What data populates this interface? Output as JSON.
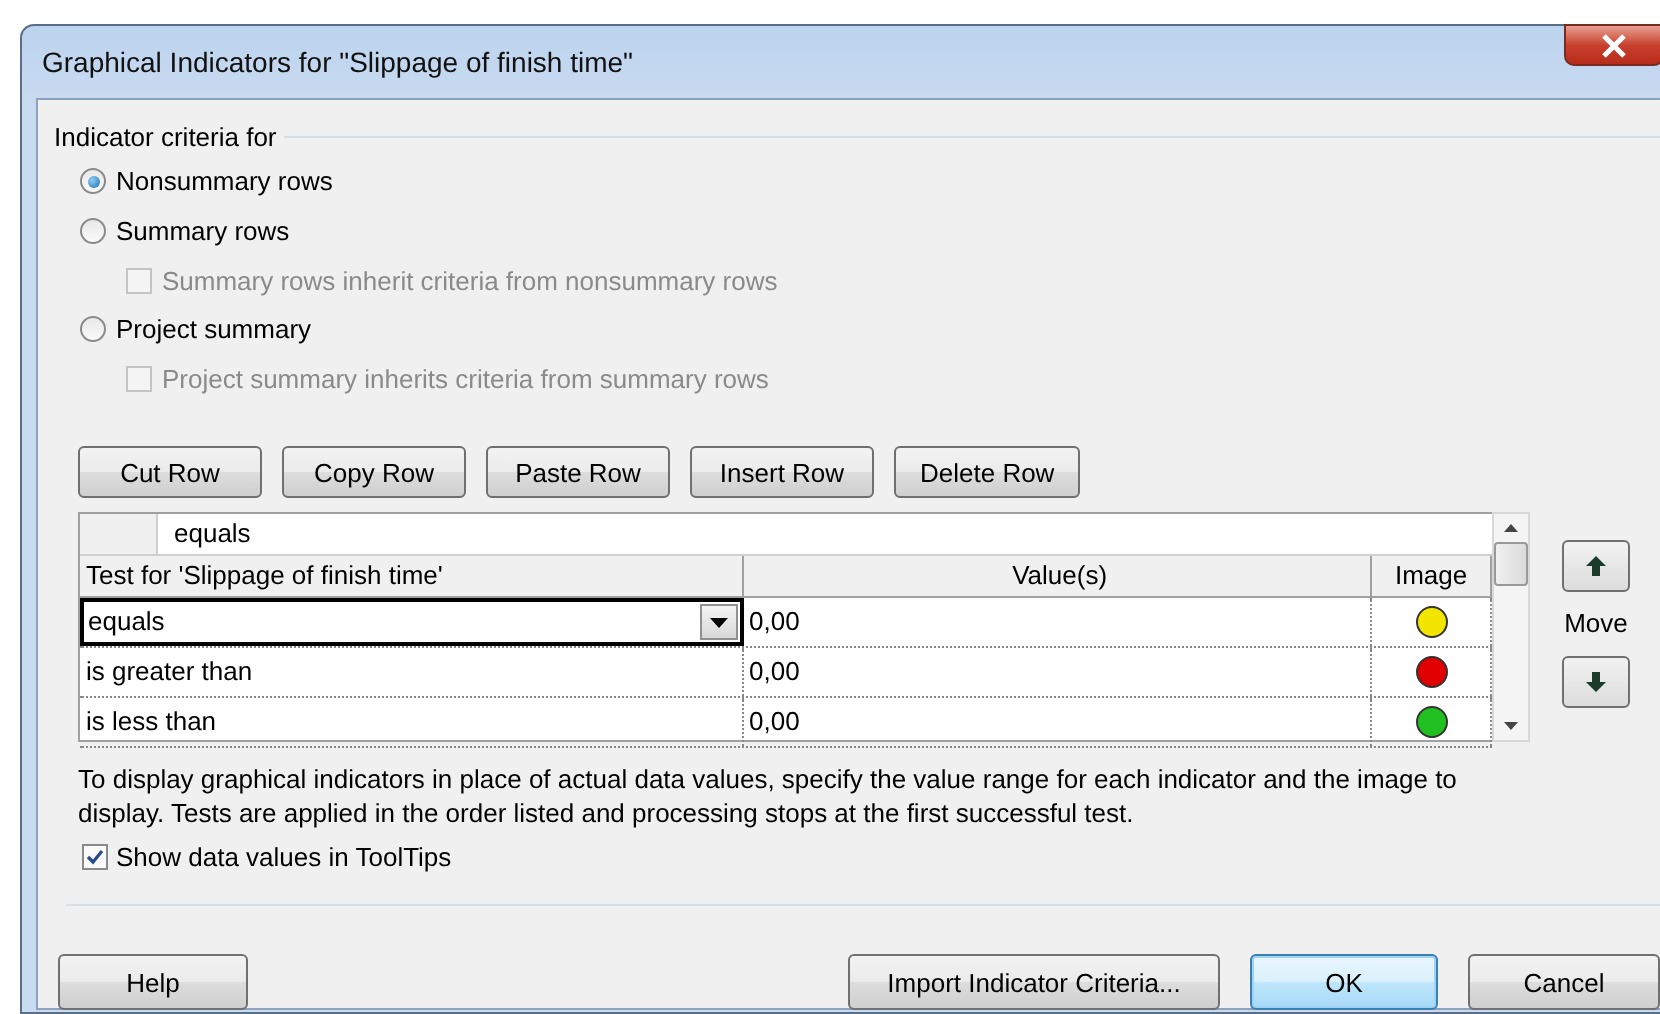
{
  "window": {
    "title": "Graphical Indicators for \"Slippage of finish time\""
  },
  "criteria": {
    "label": "Indicator criteria for",
    "options": [
      {
        "label": "Nonsummary rows",
        "selected": true
      },
      {
        "label": "Summary rows",
        "selected": false,
        "sub_option": {
          "label": "Summary rows inherit criteria from nonsummary rows",
          "checked": false,
          "disabled": true
        }
      },
      {
        "label": "Project summary",
        "selected": false,
        "sub_option": {
          "label": "Project summary inherits criteria from summary rows",
          "checked": false,
          "disabled": true
        }
      }
    ]
  },
  "row_buttons": [
    "Cut Row",
    "Copy Row",
    "Paste Row",
    "Insert Row",
    "Delete Row"
  ],
  "grid": {
    "edit_value": "equals",
    "columns": [
      "Test for 'Slippage of finish time'",
      "Value(s)",
      "Image"
    ],
    "rows": [
      {
        "test": "equals",
        "value": "0,00",
        "color": "#f2e600",
        "selected": true
      },
      {
        "test": "is greater than",
        "value": "0,00",
        "color": "#e00000",
        "selected": false
      },
      {
        "test": "is less than",
        "value": "0,00",
        "color": "#20c020",
        "selected": false
      }
    ]
  },
  "move": {
    "label": "Move"
  },
  "description": "To display graphical indicators in place of actual data values, specify the value range for each indicator and the image to display.  Tests are applied in the order listed and processing stops at the first successful test.",
  "tooltips_option": {
    "label": "Show data values in ToolTips",
    "checked": true
  },
  "buttons": [
    {
      "label": "Help",
      "kind": "normal"
    },
    {
      "label": "Import Indicator Criteria...",
      "kind": "normal"
    },
    {
      "label": "OK",
      "kind": "default"
    },
    {
      "label": "Cancel",
      "kind": "normal"
    }
  ]
}
